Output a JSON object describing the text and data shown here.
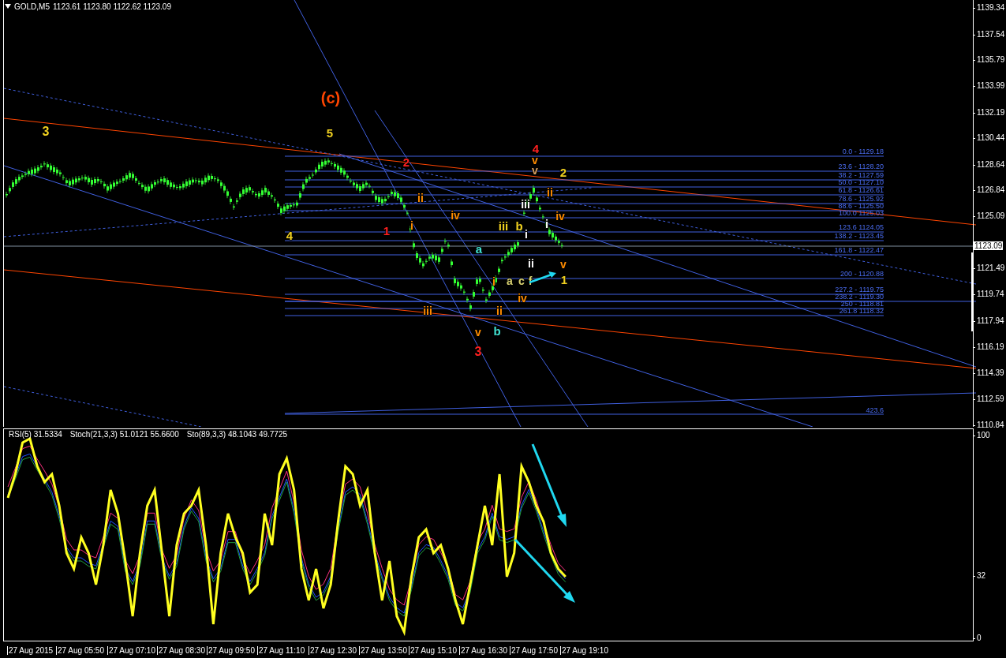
{
  "header": {
    "symbol": "GOLD,M5",
    "ohlc": "1123.61 1123.80 1122.62 1123.09"
  },
  "price_axis": {
    "labels": [
      "1139.34",
      "1137.54",
      "1135.79",
      "1133.99",
      "1132.19",
      "1130.44",
      "1128.64",
      "1126.84",
      "1125.09",
      "1121.49",
      "1119.74",
      "1117.94",
      "1116.19",
      "1114.39",
      "1112.59",
      "1110.84"
    ],
    "current_price": "1123.09"
  },
  "wave_labels": [
    {
      "text": "3",
      "color": "#f0d020"
    },
    {
      "text": "(c)",
      "color": "#ff4500"
    },
    {
      "text": "5",
      "color": "#f0d020"
    },
    {
      "text": "4",
      "color": "#f0d020"
    },
    {
      "text": "2",
      "color": "#ff2020"
    },
    {
      "text": "1",
      "color": "#ff2020"
    },
    {
      "text": "ii",
      "color": "#ff8c00"
    },
    {
      "text": "i",
      "color": "#ff8c00"
    },
    {
      "text": "iv",
      "color": "#ff8c00"
    },
    {
      "text": "iii",
      "color": "#ff8c00"
    },
    {
      "text": "v",
      "color": "#ff8c00"
    },
    {
      "text": "3",
      "color": "#ff2020"
    },
    {
      "text": "b",
      "color": "#40e0d0"
    },
    {
      "text": "a",
      "color": "#40e0d0"
    },
    {
      "text": "ii",
      "color": "#ff8c00"
    },
    {
      "text": "i",
      "color": "#ff8c00"
    },
    {
      "text": "iv",
      "color": "#ff8c00"
    },
    {
      "text": "iii",
      "color": "#f0d020"
    },
    {
      "text": "b",
      "color": "#f0d020"
    },
    {
      "text": "ii",
      "color": "#ffffff"
    },
    {
      "text": "a",
      "color": "#d8d070"
    },
    {
      "text": "c",
      "color": "#d8d070"
    },
    {
      "text": "f",
      "color": "#d8d070"
    },
    {
      "text": "iii",
      "color": "#ffffff"
    },
    {
      "text": "i",
      "color": "#ffffff"
    },
    {
      "text": "4",
      "color": "#ff2020"
    },
    {
      "text": "v",
      "color": "#ff8c00"
    },
    {
      "text": "v",
      "color": "#d8a060"
    },
    {
      "text": "2",
      "color": "#f0d020"
    },
    {
      "text": "ii",
      "color": "#ff8c00"
    },
    {
      "text": "iv",
      "color": "#ff8c00"
    },
    {
      "text": "i",
      "color": "#ffffff"
    },
    {
      "text": "v",
      "color": "#ff8c00"
    },
    {
      "text": "1",
      "color": "#f0d020"
    }
  ],
  "fib_levels": [
    "0.0 - 1129.18",
    "23.6 - 1128.20",
    "38.2 - 1127.59",
    "50.0 - 1127.10",
    "61.8 - 1126.61",
    "78.6 - 1125.92",
    "88.6 - 1125.50",
    "100.0 1125.03",
    "123.6 1124.05",
    "138.2 - 1123.45",
    "161.8 - 1122.47",
    "200 - 1120.88",
    "227.2 - 1119.75",
    "238.2 - 1119.30",
    "250 - 1118.81",
    "261.8 1118.32"
  ],
  "fib_extension": "423.6",
  "indicator": {
    "labels": [
      "RSI(5) 31.5334",
      "Stoch(21,3,3) 51.0121 55.6600",
      "Sto(89,3,3) 48.1043 49.7725"
    ],
    "axis_labels": [
      "100",
      "32",
      "0"
    ]
  },
  "time_axis": [
    "27 Aug 2015",
    "27 Aug 05:50",
    "27 Aug 07:10",
    "27 Aug 08:30",
    "27 Aug 09:50",
    "27 Aug 11:10",
    "27 Aug 12:30",
    "27 Aug 13:50",
    "27 Aug 15:10",
    "27 Aug 16:30",
    "27 Aug 17:50",
    "27 Aug 19:10"
  ]
}
